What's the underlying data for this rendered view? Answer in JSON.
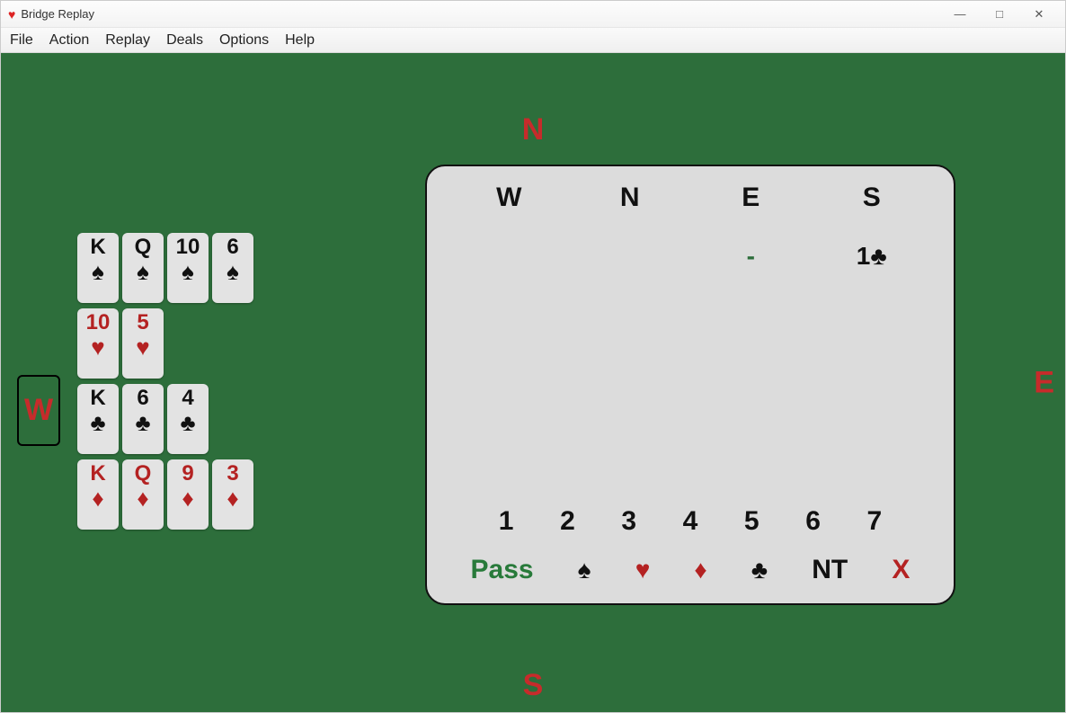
{
  "window": {
    "title": "Bridge Replay",
    "icon": "♥"
  },
  "menu": {
    "file": "File",
    "action": "Action",
    "replay": "Replay",
    "deals": "Deals",
    "options": "Options",
    "help": "Help"
  },
  "compass": {
    "n": "N",
    "s": "S",
    "e": "E",
    "w": "W"
  },
  "hand_west": {
    "spades": [
      "K",
      "Q",
      "10",
      "6"
    ],
    "hearts": [
      "10",
      "5"
    ],
    "clubs": [
      "K",
      "6",
      "4"
    ],
    "diamonds": [
      "K",
      "Q",
      "9",
      "3"
    ]
  },
  "suit_symbols": {
    "spade": "♠",
    "heart": "♥",
    "diamond": "♦",
    "club": "♣"
  },
  "bidding": {
    "headers": {
      "w": "W",
      "n": "N",
      "e": "E",
      "s": "S"
    },
    "row1": {
      "w": "",
      "n": "",
      "e": "-",
      "s_level": "1",
      "s_suit": "♣"
    },
    "levels": [
      "1",
      "2",
      "3",
      "4",
      "5",
      "6",
      "7"
    ],
    "strains": {
      "pass": "Pass",
      "spade": "♠",
      "heart": "♥",
      "diamond": "♦",
      "club": "♣",
      "nt": "NT",
      "double": "X"
    }
  }
}
